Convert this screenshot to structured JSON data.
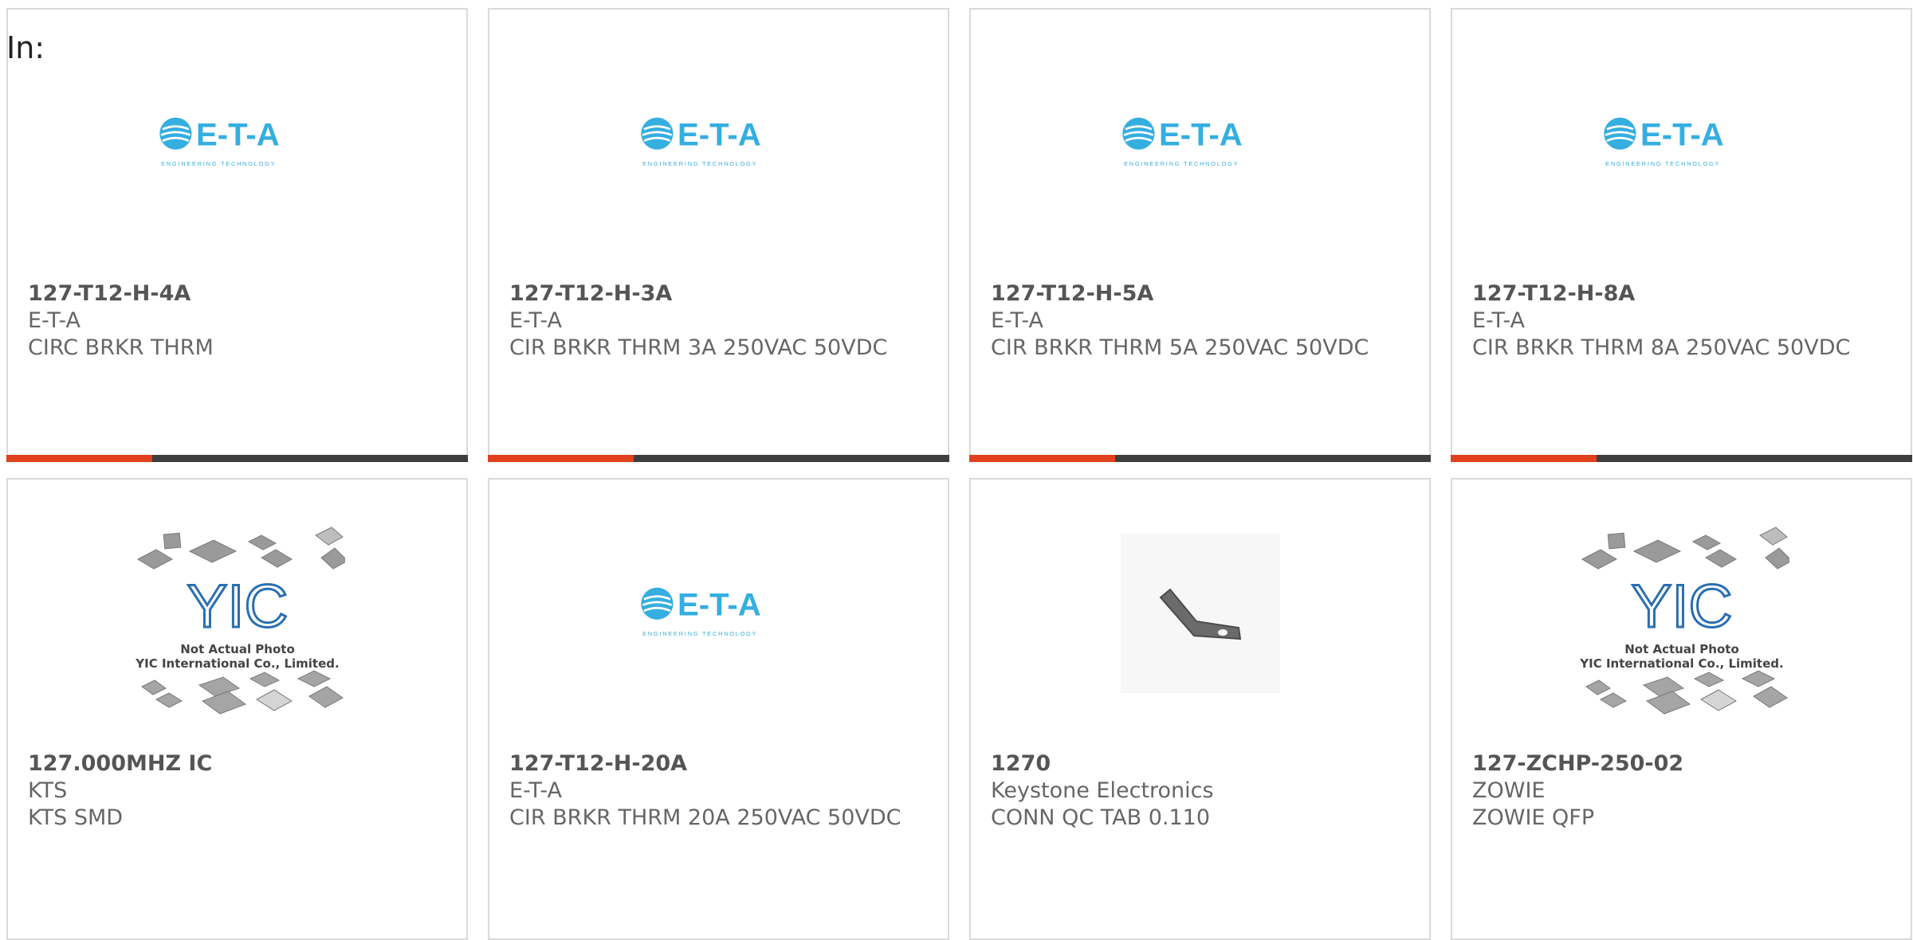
{
  "heading": "In:",
  "colors": {
    "accent": "#e0401c",
    "bar_dark": "#3e3e3e",
    "eta_blue": "#35aee0",
    "card_border": "#dadada"
  },
  "products": [
    {
      "part": "127-T12-H-4A",
      "manufacturer": "E-T-A",
      "description": "CIRC BRKR THRM",
      "image": "eta-logo",
      "logo_text": "E-T-A",
      "logo_tagline": "ENGINEERING TECHNOLOGY"
    },
    {
      "part": "127-T12-H-3A",
      "manufacturer": "E-T-A",
      "description": "CIR BRKR THRM 3A 250VAC 50VDC",
      "image": "eta-logo",
      "logo_text": "E-T-A",
      "logo_tagline": "ENGINEERING TECHNOLOGY"
    },
    {
      "part": "127-T12-H-5A",
      "manufacturer": "E-T-A",
      "description": "CIR BRKR THRM 5A 250VAC 50VDC",
      "image": "eta-logo",
      "logo_text": "E-T-A",
      "logo_tagline": "ENGINEERING TECHNOLOGY"
    },
    {
      "part": "127-T12-H-8A",
      "manufacturer": "E-T-A",
      "description": "CIR BRKR THRM 8A 250VAC 50VDC",
      "image": "eta-logo",
      "logo_text": "E-T-A",
      "logo_tagline": "ENGINEERING TECHNOLOGY"
    },
    {
      "part": "127.000MHZ IC",
      "manufacturer": "KTS",
      "description": "KTS SMD",
      "image": "yic-placeholder",
      "placeholder_line1": "Not Actual Photo",
      "placeholder_line2": "YIC International Co., Limited."
    },
    {
      "part": "127-T12-H-20A",
      "manufacturer": "E-T-A",
      "description": "CIR BRKR THRM 20A 250VAC 50VDC",
      "image": "eta-logo",
      "logo_text": "E-T-A",
      "logo_tagline": "ENGINEERING TECHNOLOGY"
    },
    {
      "part": "1270",
      "manufacturer": "Keystone Electronics",
      "description": "CONN QC TAB 0.110",
      "image": "terminal-tab-photo"
    },
    {
      "part": "127-ZCHP-250-02",
      "manufacturer": "ZOWIE",
      "description": "ZOWIE QFP",
      "image": "yic-placeholder",
      "placeholder_line1": "Not Actual Photo",
      "placeholder_line2": "YIC International Co., Limited."
    }
  ]
}
